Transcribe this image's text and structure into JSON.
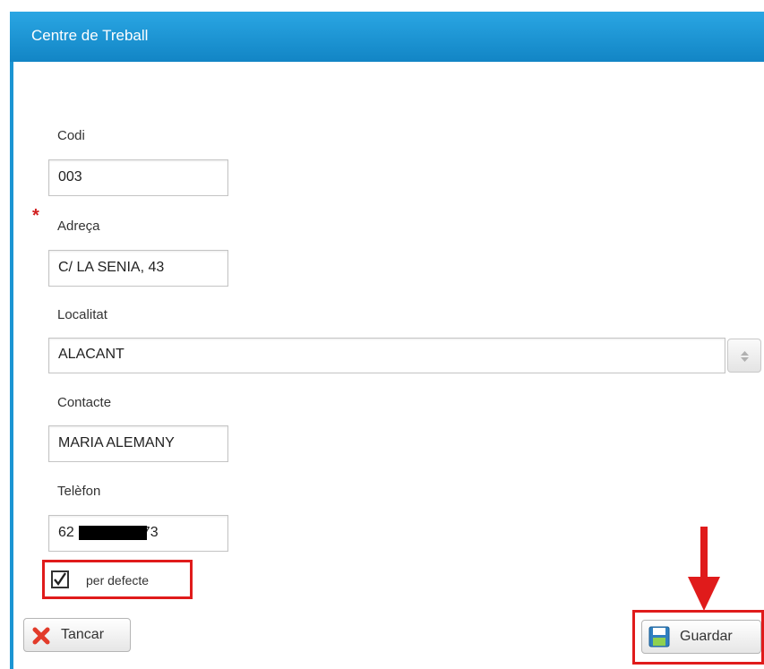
{
  "dialog": {
    "title": "Centre de Treball",
    "accent_color": "#1b95d3"
  },
  "form": {
    "codi": {
      "label": "Codi",
      "value": "003"
    },
    "adreca": {
      "label": "Adreça",
      "value": "C/ LA SENIA, 43",
      "required": true
    },
    "localitat": {
      "label": "Localitat",
      "value": "ALACANT"
    },
    "contacte": {
      "label": "Contacte",
      "value": "MARIA ALEMANY"
    },
    "telefon": {
      "label": "Telèfon",
      "value_prefix": "62",
      "value_suffix": "73",
      "redacted": true
    },
    "per_defecte": {
      "label": "per defecte",
      "checked": true
    }
  },
  "buttons": {
    "tancar": {
      "label": "Tancar",
      "icon": "close-x-icon"
    },
    "guardar": {
      "label": "Guardar",
      "icon": "floppy-disk-icon"
    }
  },
  "annotations": {
    "highlight_color": "#e01b1b"
  }
}
